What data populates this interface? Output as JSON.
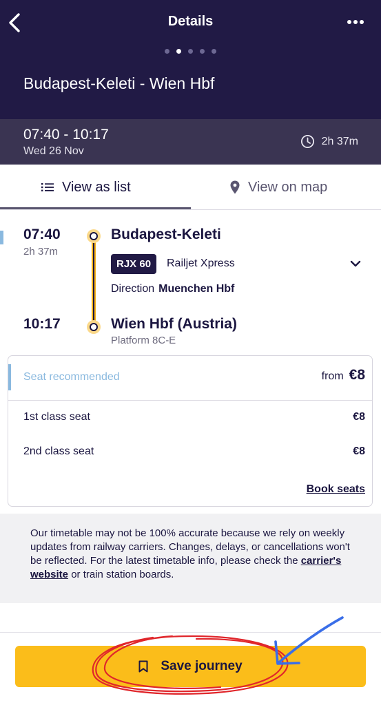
{
  "header": {
    "title": "Details",
    "route": "Budapest-Keleti - Wien Hbf",
    "page_dots": 5,
    "active_dot": 2
  },
  "timebar": {
    "time_range": "07:40 - 10:17",
    "date": "Wed 26 Nov",
    "duration": "2h 37m"
  },
  "tabs": [
    {
      "label": "View as list",
      "active": true,
      "icon": "list-icon"
    },
    {
      "label": "View on map",
      "active": false,
      "icon": "map-pin-icon"
    }
  ],
  "itinerary": {
    "departure_time": "07:40",
    "duration": "2h 37m",
    "departure_station": "Budapest-Keleti",
    "train_code": "RJX 60",
    "train_name": "Railjet Xpress",
    "direction_label": "Direction",
    "direction_value": "Muenchen Hbf",
    "arrival_time": "10:17",
    "arrival_station": "Wien Hbf (Austria)",
    "platform": "Platform 8C-E"
  },
  "seats": {
    "recommended_label": "Seat recommended",
    "from_label": "from",
    "from_price": "€8",
    "options": [
      {
        "label": "1st class seat",
        "price": "€8"
      },
      {
        "label": "2nd class seat",
        "price": "€8"
      }
    ],
    "book_label": "Book seats"
  },
  "disclaimer": {
    "text_before": "Our timetable may not be 100% accurate because we rely on weekly updates from railway carriers. Changes, delays, or cancellations won't be reflected. For the latest timetable info, please check the ",
    "link": "carrier's website",
    "text_after": " or train station boards."
  },
  "save": {
    "label": "Save journey",
    "icon": "bookmark-icon"
  },
  "colors": {
    "header_bg": "#211a45",
    "timebar_bg": "#3a3452",
    "accent_yellow": "#fbbd1a",
    "accent_blue": "#8ab9df",
    "annotation_red": "#e0262b",
    "annotation_blue": "#3a6ee8"
  }
}
